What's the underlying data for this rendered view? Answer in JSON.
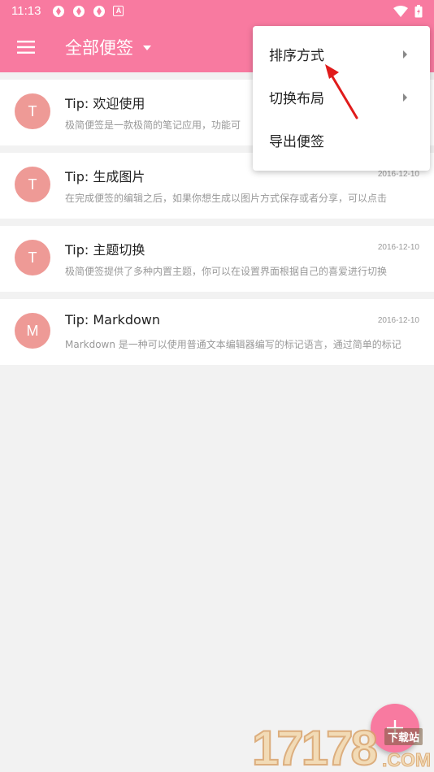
{
  "status_bar": {
    "time": "11:13",
    "a_icon_glyph": "A",
    "icons": [
      "sync-icon",
      "sync-icon",
      "sync-icon",
      "a-badge-icon",
      "wifi-icon",
      "battery-icon"
    ]
  },
  "app_bar": {
    "title": "全部便签",
    "menu_icon": "hamburger-menu-icon",
    "dropdown_icon": "caret-down-icon"
  },
  "notes": [
    {
      "avatar": "T",
      "title": "Tip: 欢迎使用",
      "date": "",
      "preview": "极简便签是一款极简的笔记应用，功能可"
    },
    {
      "avatar": "T",
      "title": "Tip: 生成图片",
      "date": "2016-12-10",
      "preview": "在完成便签的编辑之后，如果你想生成以图片方式保存或者分享，可以点击"
    },
    {
      "avatar": "T",
      "title": "Tip: 主题切换",
      "date": "2016-12-10",
      "preview": "极简便签提供了多种内置主题，你可以在设置界面根据自己的喜爱进行切换"
    },
    {
      "avatar": "M",
      "title": "Tip: Markdown",
      "date": "2016-12-10",
      "preview": "Markdown 是一种可以使用普通文本编辑器编写的标记语言，通过简单的标记"
    }
  ],
  "popup_menu": {
    "items": [
      {
        "label": "排序方式",
        "has_submenu": true
      },
      {
        "label": "切换布局",
        "has_submenu": true
      },
      {
        "label": "导出便签",
        "has_submenu": false
      }
    ]
  },
  "fab": {
    "icon": "add-icon"
  },
  "watermark": {
    "digits": "17178",
    "site": "下载站",
    "suffix": ".COM"
  },
  "colors": {
    "primary": "#f87aa0",
    "avatar": "#ee9a96",
    "background": "#f2f2f2",
    "annotation_arrow": "#e01b1b"
  }
}
